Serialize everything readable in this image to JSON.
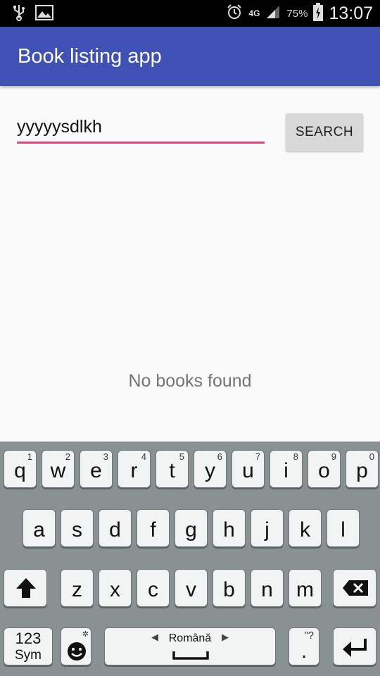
{
  "status_bar": {
    "icons_left": [
      "usb-icon",
      "image-icon"
    ],
    "alarm_icon": "alarm-icon",
    "network": "4G",
    "battery": "75%",
    "time": "13:07"
  },
  "app_bar": {
    "title": "Book listing app"
  },
  "search": {
    "value": "yyyyysdlkh",
    "button_label": "SEARCH",
    "accent_color": "#ec407a"
  },
  "empty_state": {
    "message": "No books found"
  },
  "keyboard": {
    "row1": [
      {
        "ch": "q",
        "num": "1"
      },
      {
        "ch": "w",
        "num": "2"
      },
      {
        "ch": "e",
        "num": "3"
      },
      {
        "ch": "r",
        "num": "4"
      },
      {
        "ch": "t",
        "num": "5"
      },
      {
        "ch": "y",
        "num": "6"
      },
      {
        "ch": "u",
        "num": "7"
      },
      {
        "ch": "i",
        "num": "8"
      },
      {
        "ch": "o",
        "num": "9"
      },
      {
        "ch": "p",
        "num": "0"
      }
    ],
    "row2": [
      "a",
      "s",
      "d",
      "f",
      "g",
      "h",
      "j",
      "k",
      "l"
    ],
    "row3": [
      "z",
      "x",
      "c",
      "v",
      "b",
      "n",
      "m"
    ],
    "sym_top": "123",
    "sym_bottom": "Sym",
    "space_label": "Română",
    "punct_top": "\"?",
    "punct_main": "."
  },
  "colors": {
    "app_bar": "#3f51b5",
    "keyboard_bg": "#8a9193"
  }
}
